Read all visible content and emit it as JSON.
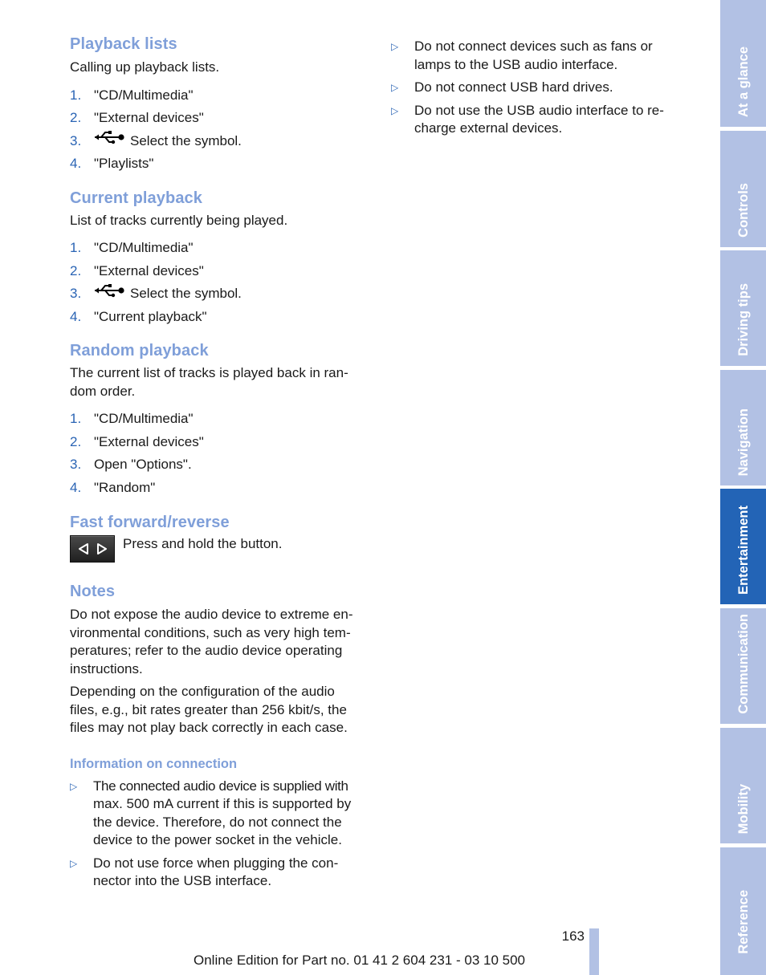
{
  "left_column": {
    "playback_lists": {
      "title": "Playback lists",
      "intro": "Calling up playback lists.",
      "steps": [
        {
          "num": "1.",
          "text": "\"CD/Multimedia\""
        },
        {
          "num": "2.",
          "text": "\"External devices\""
        },
        {
          "num": "3.",
          "icon": "usb-icon",
          "text": "Select the symbol."
        },
        {
          "num": "4.",
          "text": "\"Playlists\""
        }
      ]
    },
    "current_playback": {
      "title": "Current playback",
      "intro": "List of tracks currently being played.",
      "steps": [
        {
          "num": "1.",
          "text": "\"CD/Multimedia\""
        },
        {
          "num": "2.",
          "text": "\"External devices\""
        },
        {
          "num": "3.",
          "icon": "usb-icon",
          "text": "Select the symbol."
        },
        {
          "num": "4.",
          "text": "\"Current playback\""
        }
      ]
    },
    "random_playback": {
      "title": "Random playback",
      "intro": "The current list of tracks is played back in ran-dom order.",
      "intro_lines": [
        "The current list of tracks is played back in ran-",
        "dom order."
      ],
      "steps": [
        {
          "num": "1.",
          "text": "\"CD/Multimedia\""
        },
        {
          "num": "2.",
          "text": "\"External devices\""
        },
        {
          "num": "3.",
          "text": "Open \"Options\"."
        },
        {
          "num": "4.",
          "text": "\"Random\""
        }
      ]
    },
    "fast_forward": {
      "title": "Fast forward/reverse",
      "button_icon": "seek-buttons-icon",
      "text": "Press and hold the button."
    },
    "notes": {
      "title": "Notes",
      "paragraphs": [
        "Do not expose the audio device to extreme en-vironmental conditions, such as very high tem-peratures; refer to the audio device operating instructions.",
        "Depending on the configuration of the audio files, e.g., bit rates greater than 256 kbit/s, the files may not play back correctly in each case."
      ]
    },
    "information_on_connection": {
      "title": "Information on connection",
      "bullets": [
        "The connected audio device is supplied with max. 500 mA current if this is supported by the device. Therefore, do not connect the device to the power socket in the vehicle.",
        "Do not use force when plugging the con-nector into the USB interface."
      ]
    }
  },
  "right_column": {
    "bullets": [
      "Do not connect devices such as fans or lamps to the USB audio interface.",
      "Do not connect USB hard drives.",
      "Do not use the USB audio interface to re-charge external devices."
    ]
  },
  "bullet_glyph": "▷",
  "sidebar": {
    "tabs": [
      {
        "label": "At a glance",
        "active": false
      },
      {
        "label": "Controls",
        "active": false
      },
      {
        "label": "Driving tips",
        "active": false
      },
      {
        "label": "Navigation",
        "active": false
      },
      {
        "label": "Entertainment",
        "active": true
      },
      {
        "label": "Communication",
        "active": false
      },
      {
        "label": "Mobility",
        "active": false
      },
      {
        "label": "Reference",
        "active": false
      }
    ]
  },
  "footer": {
    "page_number": "163",
    "edition": "Online Edition for Part no. 01 41 2 604 231 - 03 10 500"
  },
  "colors": {
    "heading": "#7f9fd9",
    "step_number": "#2a64b4",
    "tab_inactive": "#b2c1e4",
    "tab_active": "#2364b6"
  }
}
